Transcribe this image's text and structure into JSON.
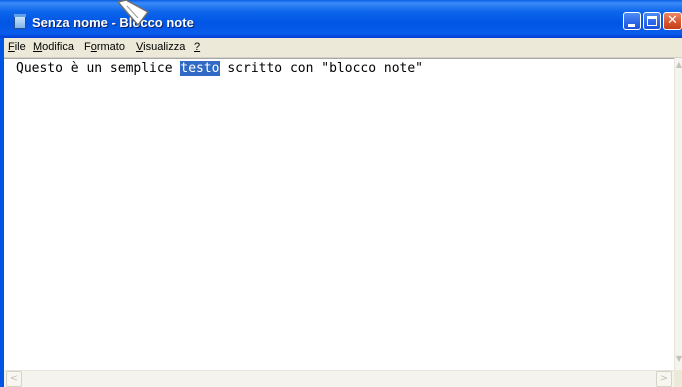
{
  "window": {
    "title": "Senza nome - Blocco note",
    "icon": "notepad-icon"
  },
  "title_buttons": {
    "minimize_icon": "minimize-icon",
    "maximize_icon": "maximize-icon",
    "close_icon": "close-icon",
    "close_glyph": "✕"
  },
  "menu": {
    "items": [
      {
        "accel": "F",
        "rest": "ile"
      },
      {
        "accel": "M",
        "rest": "odifica"
      },
      {
        "pre": "F",
        "accel": "o",
        "rest": "rmato"
      },
      {
        "accel": "V",
        "rest": "isualizza"
      },
      {
        "accel": "?",
        "rest": ""
      }
    ]
  },
  "editor": {
    "before_selection": "Questo è un semplice ",
    "selection": "testo",
    "after_selection": " scritto con \"blocco note\""
  },
  "scrollbars": {
    "up": "▲",
    "down": "▼",
    "left": "<",
    "right": ">"
  },
  "colors": {
    "titlebar": "#0055e5",
    "selection": "#316ac5",
    "menubar": "#ece9d8"
  }
}
